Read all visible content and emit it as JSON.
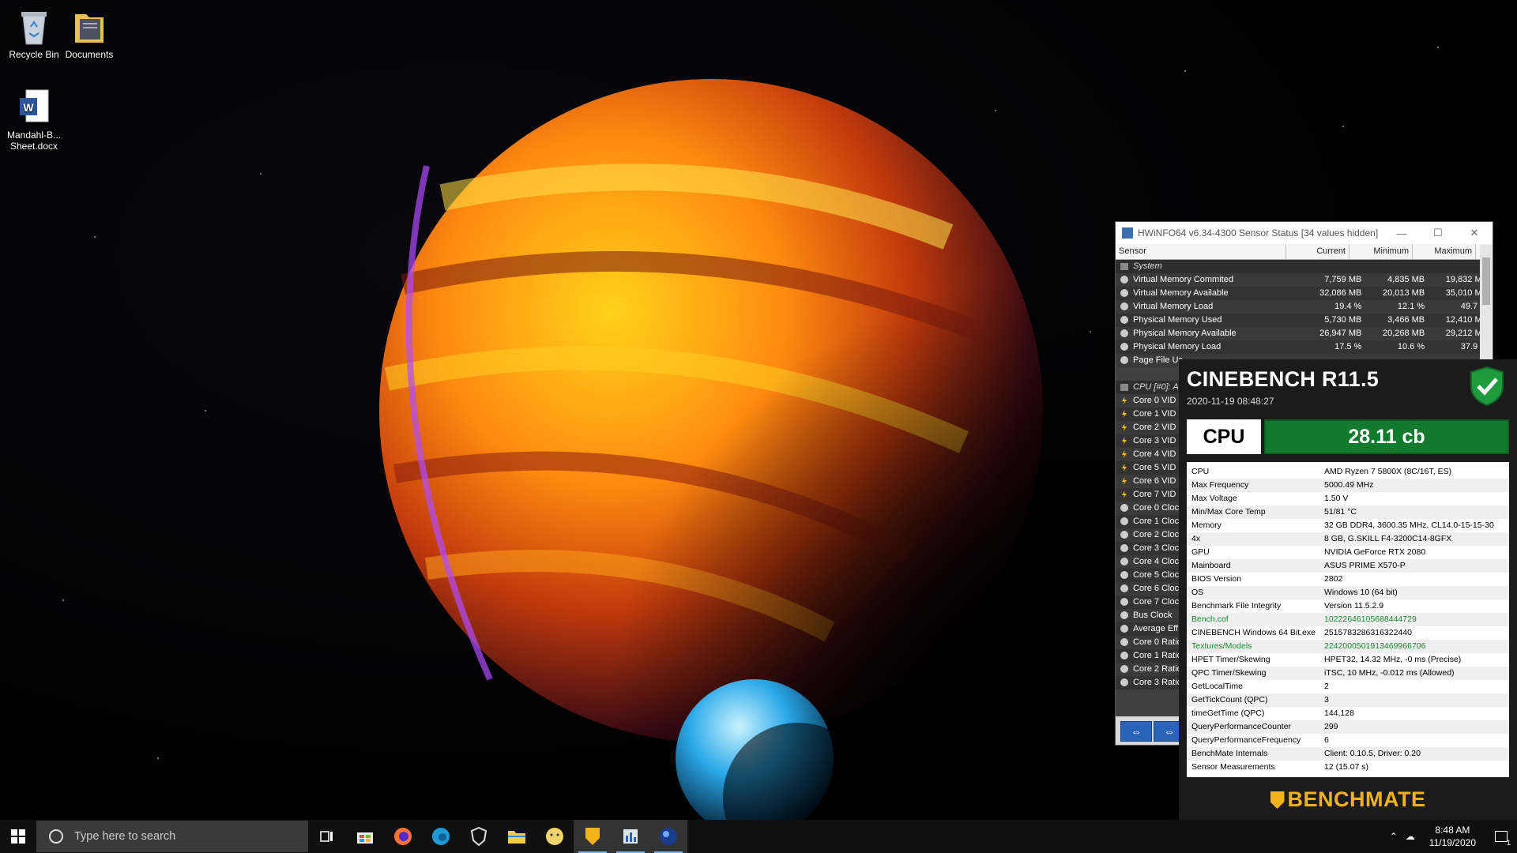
{
  "desktop": {
    "icons": [
      {
        "label": "Recycle Bin"
      },
      {
        "label": "Documents"
      },
      {
        "label": "Mandahl-B... Sheet.docx"
      }
    ]
  },
  "hwinfo": {
    "title": "HWiNFO64 v6.34-4300 Sensor Status [34 values hidden]",
    "columns": {
      "sensor": "Sensor",
      "current": "Current",
      "minimum": "Minimum",
      "maximum": "Maximum"
    },
    "group_system": "System",
    "system_rows": [
      {
        "name": "Virtual Memory Commited",
        "current": "7,759 MB",
        "min": "4,835 MB",
        "max": "19,832 MB"
      },
      {
        "name": "Virtual Memory Available",
        "current": "32,086 MB",
        "min": "20,013 MB",
        "max": "35,010 MB"
      },
      {
        "name": "Virtual Memory Load",
        "current": "19.4 %",
        "min": "12.1 %",
        "max": "49.7 %"
      },
      {
        "name": "Physical Memory Used",
        "current": "5,730 MB",
        "min": "3,466 MB",
        "max": "12,410 MB"
      },
      {
        "name": "Physical Memory Available",
        "current": "26,947 MB",
        "min": "20,268 MB",
        "max": "29,212 MB"
      },
      {
        "name": "Physical Memory Load",
        "current": "17.5 %",
        "min": "10.6 %",
        "max": "37.9 %"
      },
      {
        "name": "Page File Us",
        "current": "",
        "min": "",
        "max": ""
      }
    ],
    "group_cpu": "CPU [#0]: A",
    "cpu_rows": [
      {
        "name": "Core 0 VID",
        "icon": "bolt"
      },
      {
        "name": "Core 1 VID",
        "icon": "bolt"
      },
      {
        "name": "Core 2 VID",
        "icon": "bolt"
      },
      {
        "name": "Core 3 VID",
        "icon": "bolt"
      },
      {
        "name": "Core 4 VID",
        "icon": "bolt"
      },
      {
        "name": "Core 5 VID",
        "icon": "bolt"
      },
      {
        "name": "Core 6 VID",
        "icon": "bolt"
      },
      {
        "name": "Core 7 VID",
        "icon": "bolt"
      },
      {
        "name": "Core 0 Clock",
        "icon": "clock"
      },
      {
        "name": "Core 1 Clock",
        "icon": "clock"
      },
      {
        "name": "Core 2 Clock",
        "icon": "clock"
      },
      {
        "name": "Core 3 Clock",
        "icon": "clock"
      },
      {
        "name": "Core 4 Clock",
        "icon": "clock"
      },
      {
        "name": "Core 5 Clock",
        "icon": "clock"
      },
      {
        "name": "Core 6 Clock",
        "icon": "clock"
      },
      {
        "name": "Core 7 Clock",
        "icon": "clock"
      },
      {
        "name": "Bus Clock",
        "icon": "clock"
      },
      {
        "name": "Average Eff",
        "icon": "clock"
      },
      {
        "name": "Core 0 Ratio",
        "icon": "clock"
      },
      {
        "name": "Core 1 Ratio",
        "icon": "clock"
      },
      {
        "name": "Core 2 Ratio",
        "icon": "clock"
      },
      {
        "name": "Core 3 Ratio",
        "icon": "clock"
      }
    ]
  },
  "cinebench": {
    "title": "CINEBENCH R11.5",
    "datetime": "2020-11-19 08:48:27",
    "cpu_label": "CPU",
    "score": "28.11 cb",
    "info": [
      {
        "k": "CPU",
        "v": "AMD Ryzen 7 5800X (8C/16T, ES)"
      },
      {
        "k": "Max Frequency",
        "v": "5000.49 MHz"
      },
      {
        "k": "Max Voltage",
        "v": "1.50 V"
      },
      {
        "k": "Min/Max Core Temp",
        "v": "51/81 °C"
      },
      {
        "k": "Memory",
        "v": "32 GB DDR4, 3600.35 MHz, CL14.0-15-15-30"
      },
      {
        "k": "4x",
        "v": "8 GB, G.SKILL F4-3200C14-8GFX"
      },
      {
        "k": "GPU",
        "v": "NVIDIA GeForce RTX 2080"
      },
      {
        "k": "Mainboard",
        "v": "ASUS PRIME X570-P"
      },
      {
        "k": "BIOS Version",
        "v": "2802"
      },
      {
        "k": "OS",
        "v": "Windows 10 (64 bit)"
      },
      {
        "k": "Benchmark File Integrity",
        "v": "Version 11.5.2.9"
      },
      {
        "k": "Bench.cof",
        "v": "10222646105688444729",
        "green": true
      },
      {
        "k": "CINEBENCH Windows 64 Bit.exe",
        "v": "2515783286316322440"
      },
      {
        "k": "Textures/Models",
        "v": "2242000501913469966706",
        "green": true
      },
      {
        "k": "HPET Timer/Skewing",
        "v": "HPET32, 14.32 MHz, -0 ms (Precise)"
      },
      {
        "k": "QPC Timer/Skewing",
        "v": "iTSC, 10 MHz, -0.012 ms (Allowed)"
      },
      {
        "k": "GetLocalTime",
        "v": "2"
      },
      {
        "k": "GetTickCount (QPC)",
        "v": "3"
      },
      {
        "k": "timeGetTime (QPC)",
        "v": "144,128"
      },
      {
        "k": "QueryPerformanceCounter",
        "v": "299"
      },
      {
        "k": "QueryPerformanceFrequency",
        "v": "6"
      },
      {
        "k": "BenchMate Internals",
        "v": "Client: 0.10.5, Driver: 0.20"
      },
      {
        "k": "Sensor Measurements",
        "v": "12 (15.07 s)"
      }
    ],
    "brand": "BENCHMATE"
  },
  "taskbar": {
    "search_placeholder": "Type here to search",
    "time": "8:48 AM",
    "date": "11/19/2020",
    "notification_count": "1",
    "apps": [
      "task-view-icon",
      "store-icon",
      "firefox-icon",
      "edge-icon",
      "brave-icon",
      "file-explorer-icon",
      "emoji-app-icon",
      "benchmate-icon",
      "hwinfo-icon",
      "cinebench-icon"
    ]
  }
}
